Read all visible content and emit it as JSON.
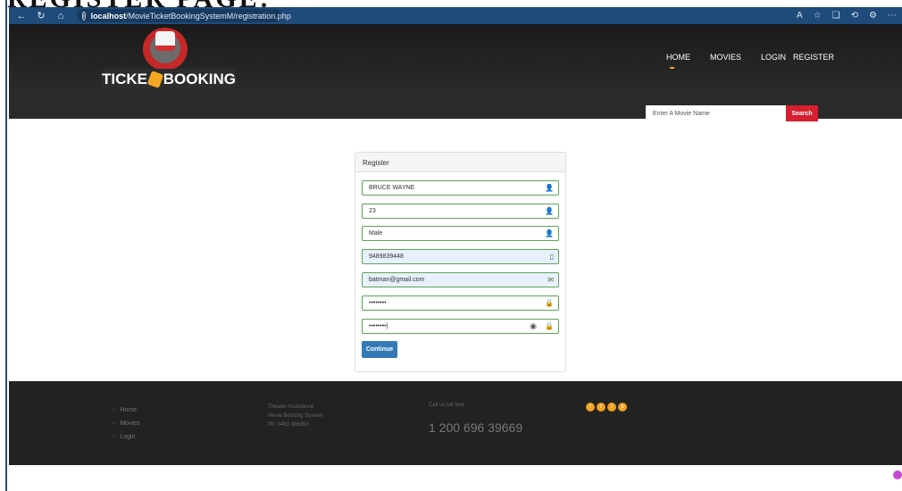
{
  "heading": "REGISTER PAGE:",
  "browser": {
    "url_host": "localhost",
    "url_path": "/MovieTicketBookingSystemM/registration.php",
    "icons": [
      "back-icon",
      "refresh-icon",
      "home-icon",
      "info-icon",
      "read-aloud-icon",
      "favorite-icon",
      "collections-icon",
      "history-icon",
      "settings-icon",
      "more-icon"
    ]
  },
  "site": {
    "logo_left": "TICKE",
    "logo_right": "BOOKING",
    "nav": [
      "HOME",
      "MOVIES",
      "LOGIN",
      "REGISTER"
    ],
    "search_placeholder": "Enter A Movie Name",
    "search_button": "Search"
  },
  "register": {
    "title": "Register",
    "fields": [
      {
        "name": "full-name",
        "value": "BRUCE WAYNE",
        "icon": "user-icon"
      },
      {
        "name": "age",
        "value": "23",
        "icon": "user-icon"
      },
      {
        "name": "gender",
        "value": " Male",
        "icon": "user-gender-icon"
      },
      {
        "name": "phone",
        "value": "9489839448",
        "icon": "phone-icon"
      },
      {
        "name": "email",
        "value": "batman@gmail.com",
        "icon": "envelope-icon"
      },
      {
        "name": "password",
        "value": "••••••••",
        "icon": "lock-icon"
      },
      {
        "name": "confirm-password",
        "value": "••••••••|",
        "icon": "lock-icon"
      }
    ],
    "continue_label": "Continue"
  },
  "footer": {
    "links": [
      "Home",
      "Movies",
      "Login"
    ],
    "info": [
      "Theater Assistance",
      "Movie Booking System",
      "Ph: 0463 086853"
    ],
    "call_label": "Call us toll free",
    "phone": "1 200 696 39669",
    "social": [
      "f",
      "t",
      "i",
      "p"
    ]
  }
}
